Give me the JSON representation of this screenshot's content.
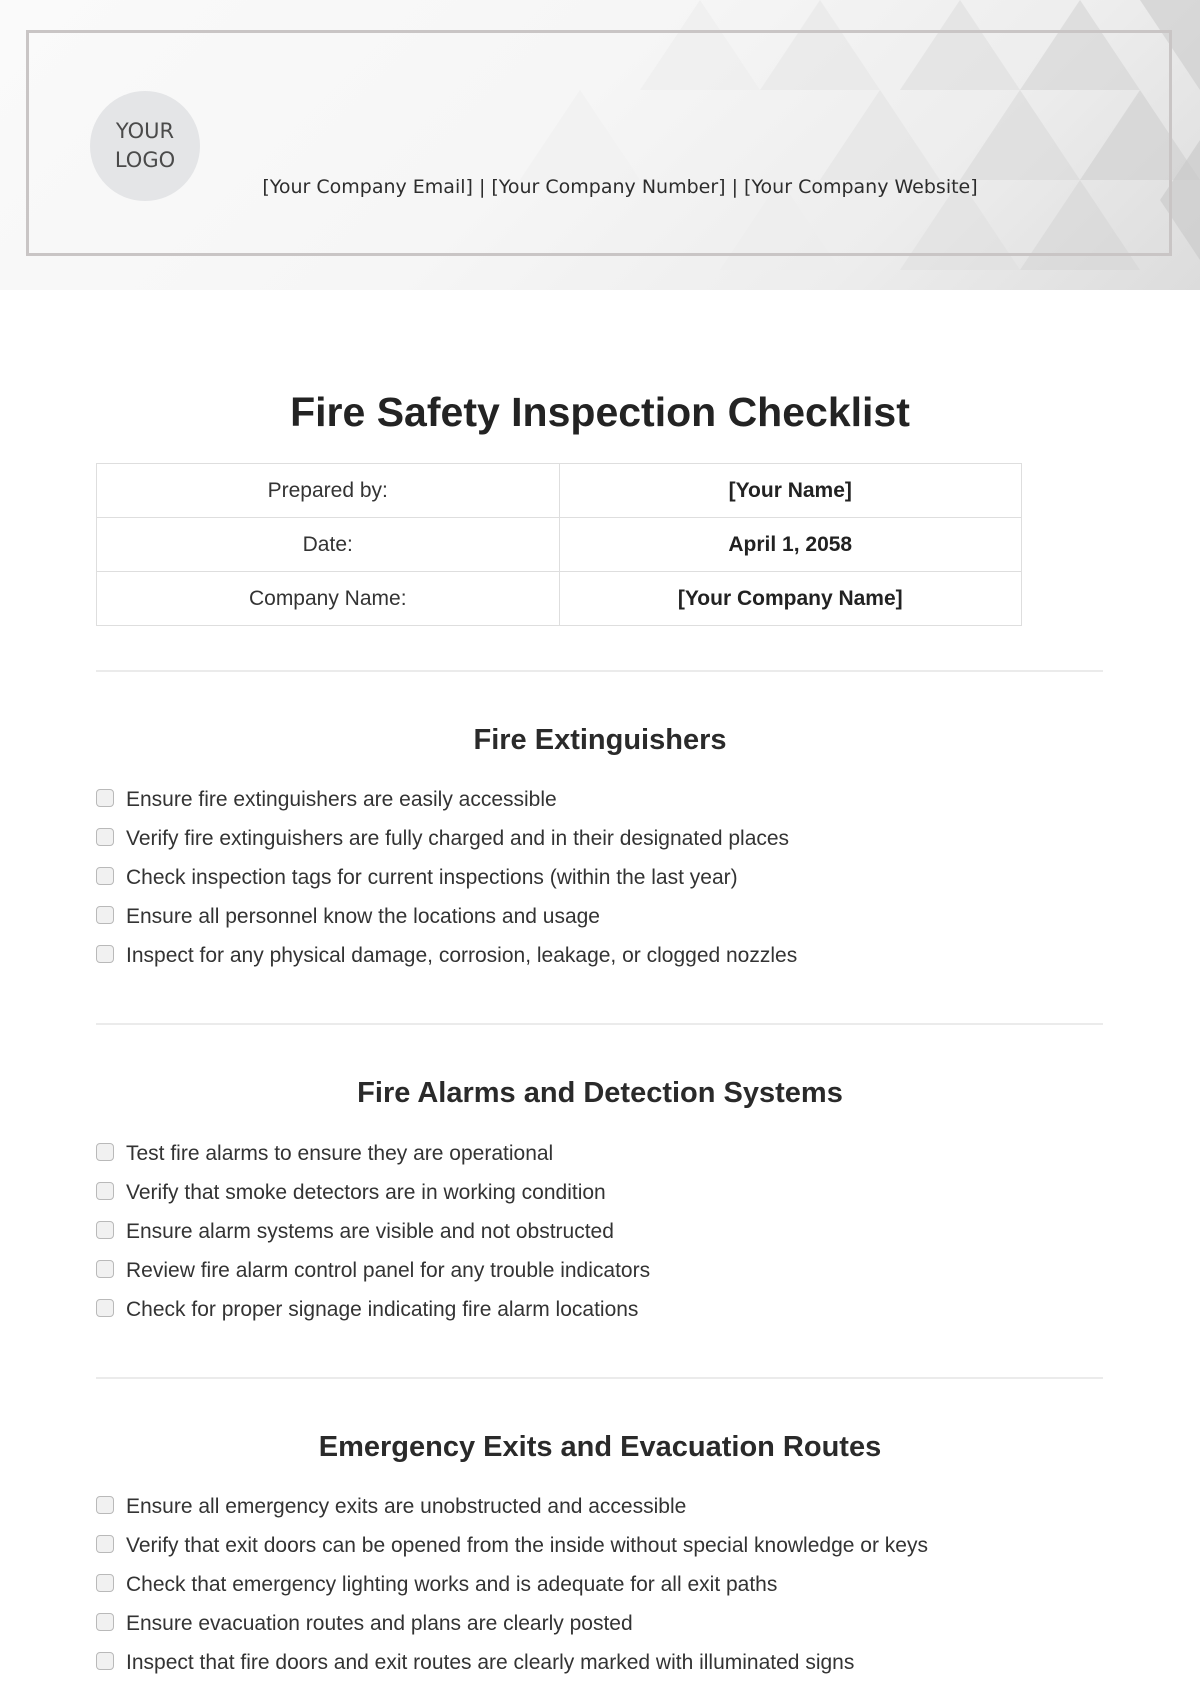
{
  "header": {
    "logo_text": "YOUR LOGO",
    "contact_line": "[Your Company Email] | [Your Company Number] | [Your Company Website]"
  },
  "document": {
    "title": "Fire Safety Inspection Checklist",
    "info_table": [
      {
        "label": "Prepared by:",
        "value": "[Your Name]"
      },
      {
        "label": "Date:",
        "value": "April 1, 2058"
      },
      {
        "label": "Company Name:",
        "value": "[Your Company Name]"
      }
    ],
    "sections": [
      {
        "title": "Fire Extinguishers",
        "items": [
          {
            "text": "Ensure fire extinguishers are easily accessible",
            "checked": false
          },
          {
            "text": "Verify fire extinguishers are fully charged and in their designated places",
            "checked": false
          },
          {
            "text": "Check inspection tags for current inspections (within the last year)",
            "checked": false
          },
          {
            "text": "Ensure all personnel know the locations and usage",
            "checked": false
          },
          {
            "text": "Inspect for any physical damage, corrosion, leakage, or clogged nozzles",
            "checked": false
          }
        ]
      },
      {
        "title": "Fire Alarms and Detection Systems",
        "items": [
          {
            "text": "Test fire alarms to ensure they are operational",
            "checked": false
          },
          {
            "text": "Verify that smoke detectors are in working condition",
            "checked": false
          },
          {
            "text": "Ensure alarm systems are visible and not obstructed",
            "checked": false
          },
          {
            "text": "Review fire alarm control panel for any trouble indicators",
            "checked": false
          },
          {
            "text": "Check for proper signage indicating fire alarm locations",
            "checked": false
          }
        ]
      },
      {
        "title": "Emergency Exits and Evacuation Routes",
        "items": [
          {
            "text": "Ensure all emergency exits are unobstructed and accessible",
            "checked": false
          },
          {
            "text": "Verify that exit doors can be opened from the inside without special knowledge or keys",
            "checked": false
          },
          {
            "text": "Check that emergency lighting works and is adequate for all exit paths",
            "checked": false
          },
          {
            "text": "Ensure evacuation routes and plans are clearly posted",
            "checked": false
          },
          {
            "text": "Inspect that fire doors and exit routes are clearly marked with illuminated signs",
            "checked": false
          }
        ]
      }
    ]
  }
}
